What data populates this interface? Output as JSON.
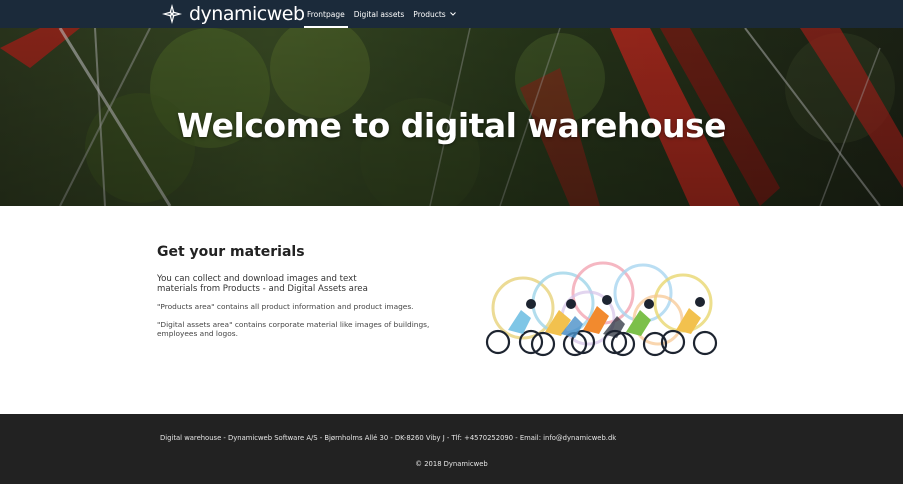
{
  "header": {
    "logo_text": "dynamicweb",
    "nav": [
      {
        "label": "Frontpage"
      },
      {
        "label": "Digital assets"
      },
      {
        "label": "Products"
      }
    ]
  },
  "hero": {
    "title": "Welcome to digital warehouse"
  },
  "main": {
    "heading": "Get your materials",
    "lead": "You can collect and download images and text materials from Products - and Digital Assets area",
    "paragraphs": [
      "\"Products area\" contains all product information and product images.",
      "\"Digital assets area\" contains corporate material like images of buildings, employees and logos."
    ]
  },
  "footer": {
    "contact": "Digital warehouse - Dynamicweb Software A/S - Bjørnholms Allé 30 - DK-8260 Viby J - Tlf: +4570252090 - Email: info@dynamicweb.dk",
    "copyright": "© 2018 Dynamicweb"
  },
  "colors": {
    "topbar": "#1b2a3a",
    "footer": "#222222",
    "accent_white": "#ffffff"
  }
}
